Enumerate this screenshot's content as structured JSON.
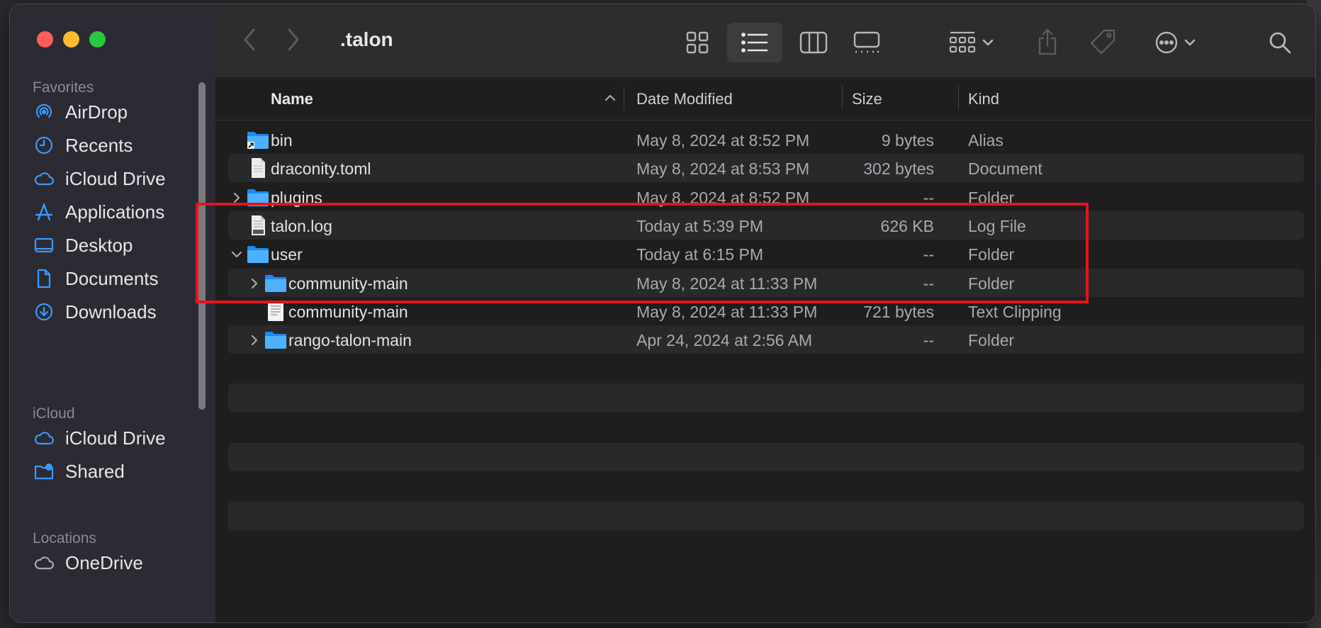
{
  "window": {
    "title": ".talon"
  },
  "sidebar": {
    "sections": [
      {
        "label": "Favorites",
        "items": [
          {
            "label": "AirDrop",
            "icon": "airdrop-icon"
          },
          {
            "label": "Recents",
            "icon": "clock-icon"
          },
          {
            "label": "iCloud Drive",
            "icon": "cloud-icon"
          },
          {
            "label": "Applications",
            "icon": "applications-icon"
          },
          {
            "label": "Desktop",
            "icon": "desktop-icon"
          },
          {
            "label": "Documents",
            "icon": "document-icon"
          },
          {
            "label": "Downloads",
            "icon": "download-icon"
          }
        ]
      },
      {
        "label": "iCloud",
        "items": [
          {
            "label": "iCloud Drive",
            "icon": "cloud-icon"
          },
          {
            "label": "Shared",
            "icon": "shared-folder-icon"
          }
        ]
      },
      {
        "label": "Locations",
        "items": [
          {
            "label": "OneDrive",
            "icon": "cloud-icon"
          }
        ]
      }
    ],
    "accent_color": "#3b99fc"
  },
  "columns": {
    "name": "Name",
    "date": "Date Modified",
    "size": "Size",
    "kind": "Kind"
  },
  "files": [
    {
      "name": "bin",
      "date": "May 8, 2024 at 8:52 PM",
      "size": "9 bytes",
      "kind": "Alias",
      "icon": "folder-alias-icon",
      "depth": 0,
      "disclosure": "none"
    },
    {
      "name": "draconity.toml",
      "date": "May 8, 2024 at 8:53 PM",
      "size": "302 bytes",
      "kind": "Document",
      "icon": "document-icon",
      "depth": 0,
      "disclosure": "none"
    },
    {
      "name": "plugins",
      "date": "May 8, 2024 at 8:52 PM",
      "size": "--",
      "kind": "Folder",
      "icon": "folder-icon",
      "depth": 0,
      "disclosure": "collapsed"
    },
    {
      "name": "talon.log",
      "date": "Today at 5:39 PM",
      "size": "626 KB",
      "kind": "Log File",
      "icon": "log-file-icon",
      "depth": 0,
      "disclosure": "none"
    },
    {
      "name": "user",
      "date": "Today at 6:15 PM",
      "size": "--",
      "kind": "Folder",
      "icon": "folder-icon",
      "depth": 0,
      "disclosure": "expanded"
    },
    {
      "name": "community-main",
      "date": "May 8, 2024 at 11:33 PM",
      "size": "--",
      "kind": "Folder",
      "icon": "folder-icon",
      "depth": 1,
      "disclosure": "collapsed"
    },
    {
      "name": "community-main",
      "date": "May 8, 2024 at 11:33 PM",
      "size": "721 bytes",
      "kind": "Text Clipping",
      "icon": "text-clipping-icon",
      "depth": 1,
      "disclosure": "none"
    },
    {
      "name": "rango-talon-main",
      "date": "Apr 24, 2024 at 2:56 AM",
      "size": "--",
      "kind": "Folder",
      "icon": "folder-icon",
      "depth": 1,
      "disclosure": "collapsed"
    }
  ],
  "highlight_color": "#e8131a"
}
